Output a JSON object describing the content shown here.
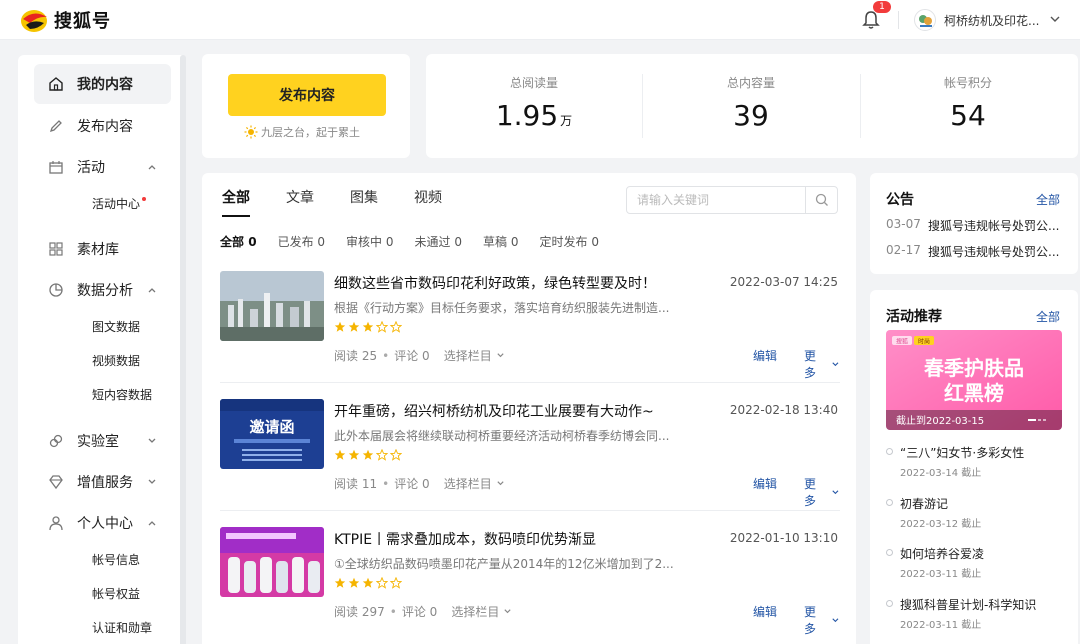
{
  "header": {
    "logo_text": "搜狐号",
    "notification_count": "1",
    "account_name": "柯桥纺机及印花..."
  },
  "sidebar": {
    "items": [
      {
        "label": "我的内容"
      },
      {
        "label": "发布内容"
      },
      {
        "label": "活动"
      },
      {
        "label": "素材库"
      },
      {
        "label": "数据分析"
      },
      {
        "label": "实验室"
      },
      {
        "label": "增值服务"
      },
      {
        "label": "个人中心"
      }
    ],
    "sub": {
      "activity_center": "活动中心",
      "text_data": "图文数据",
      "video_data": "视频数据",
      "short_data": "短内容数据",
      "account_info": "帐号信息",
      "account_rights": "帐号权益",
      "cert": "认证和勋章"
    }
  },
  "publish": {
    "button_label": "发布内容",
    "slogan": "九层之台，起于累土"
  },
  "stats": [
    {
      "label": "总阅读量",
      "value": "1.95",
      "unit": "万"
    },
    {
      "label": "总内容量",
      "value": "39",
      "unit": ""
    },
    {
      "label": "帐号积分",
      "value": "54",
      "unit": ""
    }
  ],
  "content": {
    "tabs": [
      "全部",
      "文章",
      "图集",
      "视频"
    ],
    "search_placeholder": "请输入关键词",
    "filters": [
      {
        "label": "全部",
        "count": "0"
      },
      {
        "label": "已发布",
        "count": "0"
      },
      {
        "label": "审核中",
        "count": "0"
      },
      {
        "label": "未通过",
        "count": "0"
      },
      {
        "label": "草稿",
        "count": "0"
      },
      {
        "label": "定时发布",
        "count": "0"
      }
    ],
    "read_label": "阅读",
    "comment_label": "评论",
    "column_label": "选择栏目",
    "edit_label": "编辑",
    "more_label": "更多",
    "articles": [
      {
        "title": "细数这些省市数码印花利好政策，绿色转型要及时！",
        "time": "2022-03-07 14:25",
        "desc": "根据《行动方案》目标任务要求，落实培育纺织服装先进制造...",
        "stars": 3,
        "reads": "25",
        "comments": "0"
      },
      {
        "title": "开年重磅，绍兴柯桥纺机及印花工业展要有大动作~",
        "time": "2022-02-18 13:40",
        "desc": "此外本届展会将继续联动柯桥重要经济活动柯桥春季纺博会同...",
        "stars": 3,
        "reads": "11",
        "comments": "0",
        "thumb_text": "邀请函"
      },
      {
        "title": "KTPIE丨需求叠加成本，数码喷印优势渐显",
        "time": "2022-01-10 13:10",
        "desc": "①全球纺织品数码喷墨印花产量从2014年的12亿米增加到了2...",
        "stars": 3,
        "reads": "297",
        "comments": "0"
      }
    ]
  },
  "notice": {
    "title": "公告",
    "all_label": "全部",
    "items": [
      {
        "date": "03-07",
        "text": "搜狐号违规帐号处罚公..."
      },
      {
        "date": "02-17",
        "text": "搜狐号违规帐号处罚公..."
      }
    ]
  },
  "activities": {
    "title": "活动推荐",
    "all_label": "全部",
    "banner": {
      "line1": "春季护肤品",
      "line2": "红黑榜",
      "deadline": "截止到2022-03-15",
      "tag1": "搜狐",
      "tag2": "时尚"
    },
    "items": [
      {
        "title": "“三八”妇女节·多彩女性",
        "date": "2022-03-14 截止"
      },
      {
        "title": "初春游记",
        "date": "2022-03-12 截止"
      },
      {
        "title": "如何培养谷爱凌",
        "date": "2022-03-11 截止"
      },
      {
        "title": "搜狐科普星计划-科学知识",
        "date": "2022-03-11 截止"
      }
    ]
  },
  "colors": {
    "accent": "#ffd21f",
    "link": "#2355a5",
    "star": "#f5b400"
  }
}
